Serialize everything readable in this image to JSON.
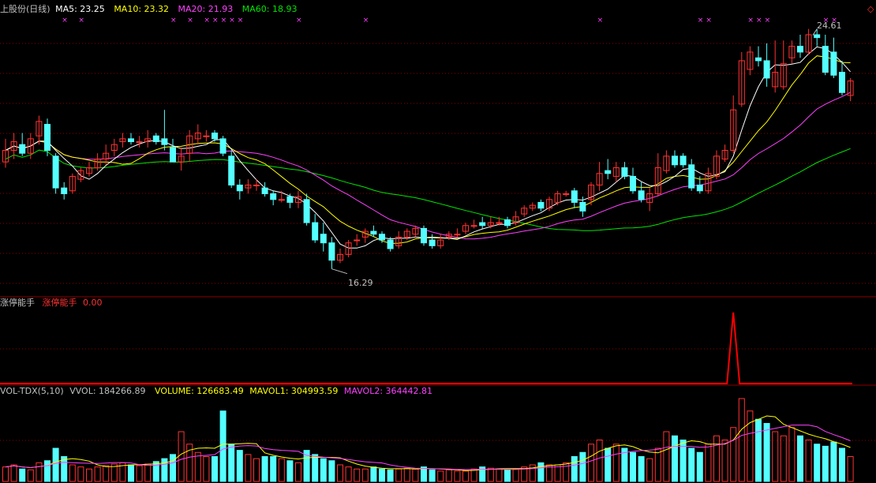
{
  "header": {
    "title": "上股份(日线)",
    "ma5": "MA5: 23.25",
    "ma10": "MA10: 23.32",
    "ma20": "MA20: 21.93",
    "ma60": "MA60: 18.93"
  },
  "indicator": {
    "name": "涨停能手",
    "name2": "涨停能手",
    "value": "0.00"
  },
  "volume_header": {
    "name": "VOL-TDX(5,10)",
    "vvol": "VVOL: 184266.89",
    "volume": "VOLUME: 126683.49",
    "mavol1": "MAVOL1: 304993.59",
    "mavol2": "MAVOL2: 364442.81"
  },
  "annotations": {
    "high": "24.61",
    "low": "16.29"
  },
  "colors": {
    "up": "#ff3232",
    "down": "#54ffff",
    "ma5": "#ffffff",
    "ma10": "#ffff00",
    "ma20": "#ff40ff",
    "ma60": "#00e600",
    "grid": "#8b0000",
    "signal": "#ff0000"
  },
  "chart_data": {
    "type": "candlestick",
    "o": [
      20.0,
      20.4,
      20.6,
      20.3,
      20.9,
      21.3,
      20.2,
      19.1,
      19.0,
      19.4,
      19.6,
      19.8,
      20.1,
      20.4,
      20.7,
      20.8,
      20.7,
      20.7,
      20.9,
      20.8,
      20.5,
      20.0,
      20.3,
      20.8,
      20.9,
      21.0,
      20.8,
      20.2,
      19.2,
      19.1,
      19.2,
      19.1,
      18.9,
      18.7,
      18.8,
      18.6,
      18.7,
      17.9,
      17.5,
      17.2,
      16.6,
      16.8,
      17.3,
      17.4,
      17.6,
      17.5,
      17.3,
      17.1,
      17.4,
      17.5,
      17.7,
      17.3,
      17.1,
      17.4,
      17.5,
      17.6,
      17.8,
      17.9,
      17.8,
      17.9,
      18.0,
      17.9,
      18.2,
      18.4,
      18.6,
      18.4,
      18.6,
      18.9,
      19.0,
      18.6,
      18.7,
      19.2,
      19.7,
      19.5,
      19.8,
      19.5,
      19.0,
      18.6,
      18.9,
      19.7,
      20.2,
      20.2,
      19.9,
      19.2,
      19.0,
      19.5,
      20.1,
      20.4,
      22.0,
      23.2,
      23.6,
      23.5,
      22.6,
      22.6,
      23.6,
      24.0,
      23.8,
      24.4,
      24.0,
      23.8,
      23.1,
      22.3
    ],
    "c": [
      20.4,
      20.7,
      20.3,
      20.8,
      21.4,
      20.4,
      19.1,
      18.9,
      19.5,
      19.7,
      19.8,
      20.1,
      20.3,
      20.6,
      20.8,
      20.7,
      20.7,
      20.8,
      20.7,
      20.6,
      20.0,
      20.2,
      20.9,
      21.0,
      20.9,
      20.8,
      20.3,
      19.2,
      19.0,
      19.2,
      19.2,
      18.9,
      18.7,
      18.7,
      18.6,
      18.8,
      17.9,
      17.3,
      17.2,
      16.6,
      16.8,
      17.2,
      17.3,
      17.6,
      17.5,
      17.3,
      17.0,
      17.4,
      17.6,
      17.7,
      17.2,
      17.1,
      17.3,
      17.5,
      17.5,
      17.8,
      17.8,
      17.8,
      17.9,
      17.9,
      17.8,
      18.1,
      18.4,
      18.5,
      18.4,
      18.7,
      18.9,
      18.9,
      18.6,
      18.3,
      19.2,
      19.6,
      19.6,
      19.8,
      19.5,
      19.0,
      18.7,
      18.9,
      19.8,
      20.2,
      19.9,
      19.9,
      19.1,
      19.0,
      19.6,
      20.2,
      20.4,
      21.8,
      23.5,
      23.8,
      23.5,
      22.9,
      23.1,
      23.4,
      24.0,
      23.8,
      24.4,
      24.3,
      23.1,
      23.0,
      22.4,
      22.8
    ],
    "h": [
      20.8,
      21.0,
      21.0,
      21.0,
      21.6,
      21.5,
      20.3,
      19.3,
      19.6,
      19.8,
      20.0,
      20.3,
      20.6,
      20.8,
      21.0,
      21.0,
      20.9,
      21.1,
      21.0,
      21.8,
      20.8,
      20.5,
      21.1,
      21.3,
      21.1,
      21.1,
      20.9,
      20.4,
      19.4,
      19.4,
      19.4,
      19.3,
      19.0,
      19.0,
      18.9,
      19.0,
      18.9,
      18.2,
      17.9,
      17.4,
      17.0,
      17.3,
      17.5,
      17.7,
      17.8,
      17.6,
      17.4,
      17.6,
      17.7,
      17.8,
      17.8,
      17.5,
      17.5,
      17.6,
      17.7,
      17.9,
      18.0,
      18.1,
      18.1,
      18.1,
      18.1,
      18.3,
      18.5,
      18.6,
      18.7,
      18.8,
      19.0,
      19.0,
      19.1,
      18.8,
      19.3,
      20.0,
      20.1,
      20.0,
      20.0,
      19.8,
      19.3,
      19.1,
      20.3,
      20.4,
      20.4,
      20.3,
      20.1,
      19.5,
      19.8,
      20.4,
      20.6,
      22.3,
      23.8,
      24.0,
      24.0,
      24.1,
      24.2,
      24.2,
      24.2,
      24.4,
      24.6,
      24.6,
      24.4,
      24.3,
      23.5,
      22.9
    ],
    "l": [
      19.8,
      20.1,
      20.2,
      20.1,
      20.6,
      20.2,
      18.9,
      18.7,
      18.9,
      19.3,
      19.5,
      19.7,
      19.9,
      20.2,
      20.5,
      20.6,
      20.5,
      20.5,
      20.6,
      20.4,
      20.0,
      19.7,
      20.0,
      20.6,
      20.7,
      20.7,
      20.2,
      19.1,
      18.7,
      18.9,
      19.0,
      18.8,
      18.5,
      18.6,
      18.4,
      18.4,
      17.8,
      17.2,
      16.9,
      16.3,
      16.5,
      16.7,
      17.1,
      17.2,
      17.4,
      17.2,
      16.9,
      17.0,
      17.3,
      17.4,
      17.1,
      17.0,
      17.0,
      17.3,
      17.4,
      17.5,
      17.7,
      17.7,
      17.7,
      17.8,
      17.7,
      17.8,
      18.1,
      18.3,
      18.3,
      18.3,
      18.5,
      18.8,
      18.4,
      18.1,
      18.5,
      19.0,
      19.4,
      19.3,
      19.4,
      18.9,
      18.6,
      18.3,
      18.8,
      19.6,
      19.8,
      19.8,
      19.0,
      18.9,
      18.9,
      19.4,
      20.0,
      20.3,
      21.9,
      23.0,
      23.3,
      22.6,
      22.4,
      22.5,
      23.4,
      23.6,
      23.7,
      24.0,
      23.0,
      22.9,
      22.3,
      22.1
    ],
    "vol": [
      35,
      40,
      30,
      28,
      45,
      50,
      80,
      60,
      40,
      35,
      30,
      35,
      38,
      42,
      45,
      40,
      38,
      42,
      48,
      55,
      65,
      120,
      90,
      70,
      60,
      60,
      170,
      90,
      75,
      65,
      55,
      60,
      60,
      55,
      50,
      45,
      75,
      65,
      55,
      50,
      40,
      35,
      30,
      30,
      35,
      30,
      28,
      30,
      32,
      30,
      35,
      28,
      25,
      28,
      25,
      25,
      30,
      35,
      32,
      30,
      28,
      30,
      35,
      40,
      45,
      40,
      40,
      45,
      60,
      70,
      90,
      100,
      80,
      90,
      80,
      70,
      60,
      55,
      80,
      120,
      110,
      100,
      80,
      70,
      90,
      110,
      100,
      130,
      200,
      170,
      150,
      140,
      120,
      110,
      130,
      110,
      100,
      90,
      85,
      95,
      80,
      60
    ],
    "zt_spike_index": 87,
    "price_range": [
      15.5,
      25.0
    ]
  }
}
